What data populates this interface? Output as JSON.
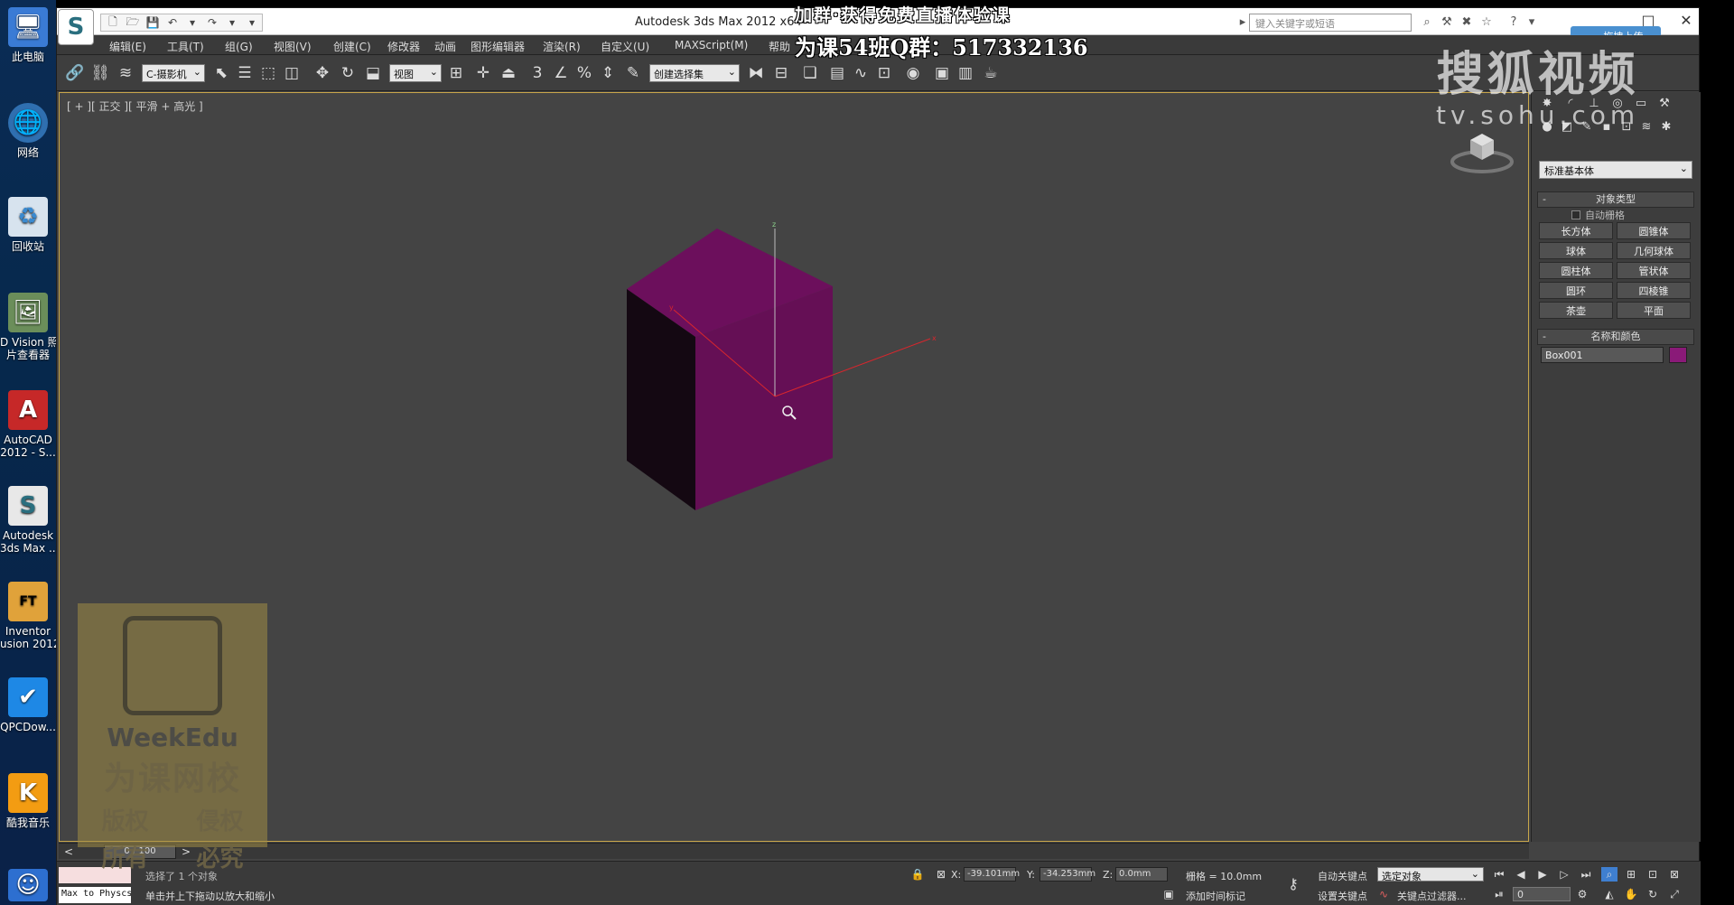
{
  "desktop": {
    "icons": [
      {
        "label": "此电脑",
        "icon": "computer-icon"
      },
      {
        "label": "网络",
        "icon": "network-icon"
      },
      {
        "label": "回收站",
        "icon": "recycle-bin-icon"
      },
      {
        "label": "D Vision 照片查看器",
        "label1": "D Vision 照",
        "label2": "片查看器",
        "icon": "photo-viewer-icon"
      },
      {
        "label1": "AutoCAD",
        "label2": "2012 - S...",
        "icon": "autocad-icon"
      },
      {
        "label1": "Autodesk",
        "label2": "3ds Max ...",
        "icon": "3dsmax-icon"
      },
      {
        "label1": "Inventor",
        "label2": "usion 2012",
        "icon": "inventor-icon"
      },
      {
        "label": "QPCDow...",
        "icon": "qpcdownload-icon"
      },
      {
        "label": "酷我音乐",
        "icon": "kuwo-music-icon"
      }
    ]
  },
  "window": {
    "title": "Autodesk 3ds Max  2012 x64",
    "search_placeholder": "键入关键字或短语",
    "upload_button": "拖拽上传"
  },
  "menu": [
    "编辑(E)",
    "工具(T)",
    "组(G)",
    "视图(V)",
    "创建(C)",
    "修改器",
    "动画",
    "图形编辑器",
    "渲染(R)",
    "自定义(U)",
    "MAXScript(M)",
    "帮助"
  ],
  "toolbar": {
    "filter_select": "C-摄影机",
    "ref_coord_select": "视图",
    "named_selection": "创建选择集"
  },
  "viewport": {
    "label": "[ + ] [ 正交 ] [ 平滑 + 高光 ]",
    "label_text": "[ + ][ 正交 ][ 平滑 + 高光 ]",
    "object_color": "#7a1265"
  },
  "command_panel": {
    "category_select": "标准基本体",
    "object_type_title": "对象类型",
    "autogrid_label": "自动栅格",
    "buttons": [
      "长方体",
      "圆锥体",
      "球体",
      "几何球体",
      "圆柱体",
      "管状体",
      "圆环",
      "四棱锥",
      "茶壶",
      "平面"
    ],
    "name_color_title": "名称和颜色",
    "object_name": "Box001",
    "object_color": "#8a1a78"
  },
  "timeline": {
    "frame": "0 / 100"
  },
  "status": {
    "selection_text": "选择了 1 个对象",
    "prompt_text": "单击并上下拖动以放大和缩小",
    "listener_text": "Max to Physcs (",
    "x_label": "X:",
    "x_value": "-39.101mm",
    "y_label": "Y:",
    "y_value": "-34.253mm",
    "z_label": "Z:",
    "z_value": "0.0mm",
    "grid_text": "栅格 = 10.0mm",
    "add_time_tag": "添加时间标记",
    "auto_key": "自动关键点",
    "set_key": "设置关键点",
    "key_select": "选定对象",
    "key_filter": "关键点过滤器...",
    "frame_field": "0"
  },
  "overlays": {
    "ad_line1": "加群·获得免费直播体验课",
    "ad_line2": "为课54班Q群：517332136",
    "sohu_big": "搜狐视频",
    "sohu_small": "tv.sohu.com",
    "weekedu_brand": "WeekEdu",
    "weekedu_cn": "为课网校",
    "weekedu_rights1": "版权",
    "weekedu_rights2": "侵权",
    "weekedu_rights3": "所有",
    "weekedu_rights4": "必究"
  }
}
